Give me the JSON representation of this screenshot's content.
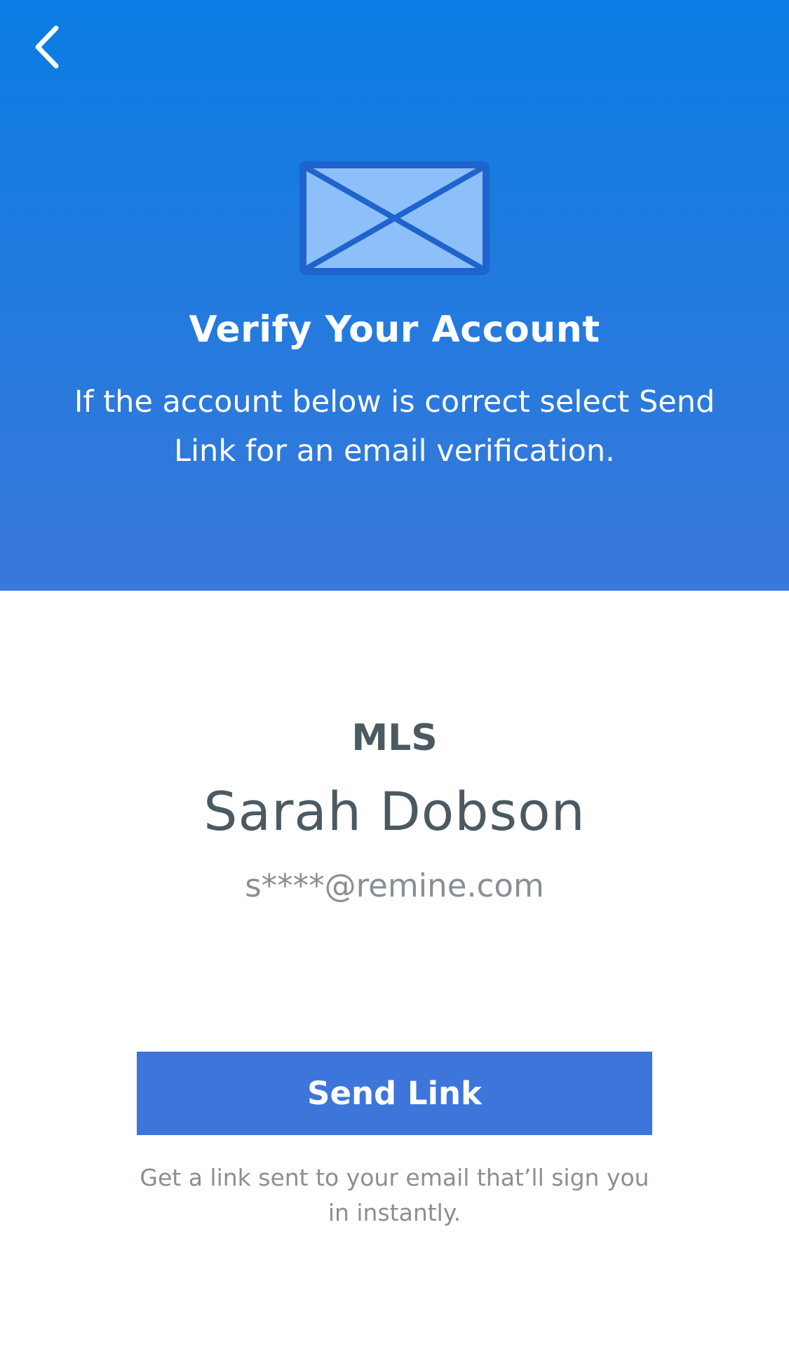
{
  "header": {
    "back_icon": "chevron-left-icon",
    "envelope_icon": "envelope-icon",
    "title": "Verify Your Account",
    "subtitle": "If the account below is correct select Send Link for an email verification."
  },
  "account": {
    "type": "MLS",
    "name": "Sarah Dobson",
    "email": "s****@remine.com"
  },
  "actions": {
    "send_link_label": "Send Link",
    "help_text": "Get a link sent to your email that’ll sign you in instantly."
  },
  "colors": {
    "hero_top": "#0a7ce3",
    "hero_bottom": "#3a78da",
    "button": "#3d75db",
    "envelope_fill": "#8dc0fb",
    "envelope_stroke": "#1f63cd",
    "name_text": "#4b5a61",
    "muted_text": "#8a8f93"
  }
}
